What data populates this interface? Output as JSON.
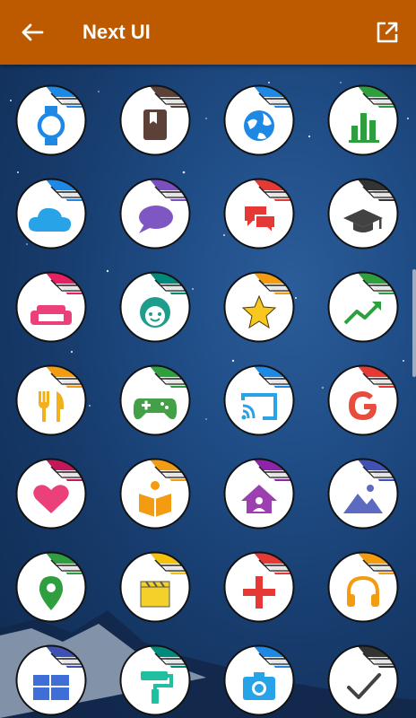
{
  "app": {
    "title": "Next UI",
    "back_icon": "arrow-back-icon",
    "open_icon": "open-in-new-icon",
    "bar_color": "#bd5a00"
  },
  "icons": [
    {
      "name": "watch-icon",
      "tab": "#1e88e5",
      "glyph": "watch",
      "color": "#1e88e5"
    },
    {
      "name": "book-icon",
      "tab": "#5d4037",
      "glyph": "book",
      "color": "#5d4037"
    },
    {
      "name": "globe-icon",
      "tab": "#1e88e5",
      "glyph": "globe",
      "color": "#1e88e5"
    },
    {
      "name": "bar-chart-icon",
      "tab": "#2e9e3e",
      "glyph": "bars",
      "color": "#2e9e3e"
    },
    {
      "name": "cloud-icon",
      "tab": "#1e88e5",
      "glyph": "cloud",
      "color": "#29a3e8"
    },
    {
      "name": "speech-bubble-icon",
      "tab": "#7b4fc0",
      "glyph": "speech",
      "color": "#7e57c2"
    },
    {
      "name": "chat-icon",
      "tab": "#e53935",
      "glyph": "chat",
      "color": "#e53935"
    },
    {
      "name": "graduation-cap-icon",
      "tab": "#333333",
      "glyph": "cap",
      "color": "#424242"
    },
    {
      "name": "sofa-icon",
      "tab": "#e91e63",
      "glyph": "sofa",
      "color": "#ec407a"
    },
    {
      "name": "face-icon",
      "tab": "#00897b",
      "glyph": "face",
      "color": "#1e9c8c"
    },
    {
      "name": "star-icon",
      "tab": "#f39c12",
      "glyph": "star",
      "color": "#f9c820"
    },
    {
      "name": "trending-up-icon",
      "tab": "#2e9e3e",
      "glyph": "trend",
      "color": "#2e9e3e"
    },
    {
      "name": "restaurant-icon",
      "tab": "#f39c12",
      "glyph": "fork",
      "color": "#f2b01c"
    },
    {
      "name": "gamepad-icon",
      "tab": "#2e9e3e",
      "glyph": "game",
      "color": "#43a047"
    },
    {
      "name": "cast-icon",
      "tab": "#1e88e5",
      "glyph": "cast",
      "color": "#29a3e8"
    },
    {
      "name": "google-icon",
      "tab": "#e53935",
      "glyph": "google",
      "color": "#e74c3c"
    },
    {
      "name": "heart-icon",
      "tab": "#c2185b",
      "glyph": "heart",
      "color": "#ec407a"
    },
    {
      "name": "reader-icon",
      "tab": "#f39c12",
      "glyph": "reader",
      "color": "#f39c12"
    },
    {
      "name": "home-icon",
      "tab": "#8e24aa",
      "glyph": "home",
      "color": "#9c3fb0"
    },
    {
      "name": "landscape-icon",
      "tab": "#3f51b5",
      "glyph": "landscape",
      "color": "#5c6bc0"
    },
    {
      "name": "location-pin-icon",
      "tab": "#2e9e3e",
      "glyph": "pin",
      "color": "#2e9e3e"
    },
    {
      "name": "clapper-icon",
      "tab": "#f4c20d",
      "glyph": "clapper",
      "color": "#f4d02a"
    },
    {
      "name": "plus-icon",
      "tab": "#e53935",
      "glyph": "plus",
      "color": "#e53935"
    },
    {
      "name": "headphones-icon",
      "tab": "#f39c12",
      "glyph": "headphones",
      "color": "#f39c12"
    },
    {
      "name": "dashboard-icon",
      "tab": "#3f51b5",
      "glyph": "dash",
      "color": "#3f6fd6"
    },
    {
      "name": "paint-roller-icon",
      "tab": "#00897b",
      "glyph": "roller",
      "color": "#1fbf9f"
    },
    {
      "name": "camera-icon",
      "tab": "#1e88e5",
      "glyph": "camera",
      "color": "#29a3e8"
    },
    {
      "name": "check-icon",
      "tab": "#333333",
      "glyph": "check",
      "color": "#424242"
    }
  ]
}
